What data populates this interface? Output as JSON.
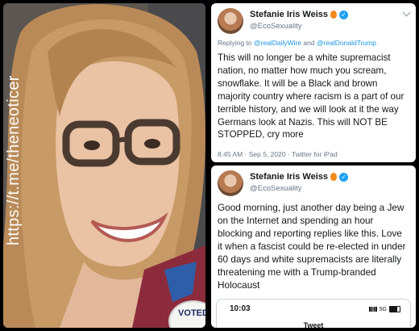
{
  "photo": {
    "watermark": "https://t.me/theneoticer",
    "sticker_text": "VOTED"
  },
  "tweets": [
    {
      "name": "Stefanie Iris Weiss",
      "handle": "@EcoSexuality",
      "reply_prefix": "Replying to ",
      "reply_mention_1": "@realDailyWire",
      "reply_and": " and ",
      "reply_mention_2": "@realDonaldTrump",
      "body": "This will no longer be a white supremacist nation, no matter how much you scream, snowflake. It will be a Black and brown majority country where racism is a part of our terrible history, and we will look at it the way Germans look at Nazis. This will NOT BE STOPPED, cry more",
      "meta": "8:45 AM · Sep 5, 2020 · Twitter for iPad"
    },
    {
      "name": "Stefanie Iris Weiss",
      "handle": "@EcoSexuality",
      "body": "Good morning, just another day being a Jew on the Internet and spending an hour blocking and reporting replies like this. Love it when a fascist could be re-elected in under 60 days and white supremacists are literally threatening me with a Trump-branded Holocaust",
      "embed_time": "10:03",
      "embed_network": "5G",
      "embed_title": "Tweet"
    }
  ]
}
